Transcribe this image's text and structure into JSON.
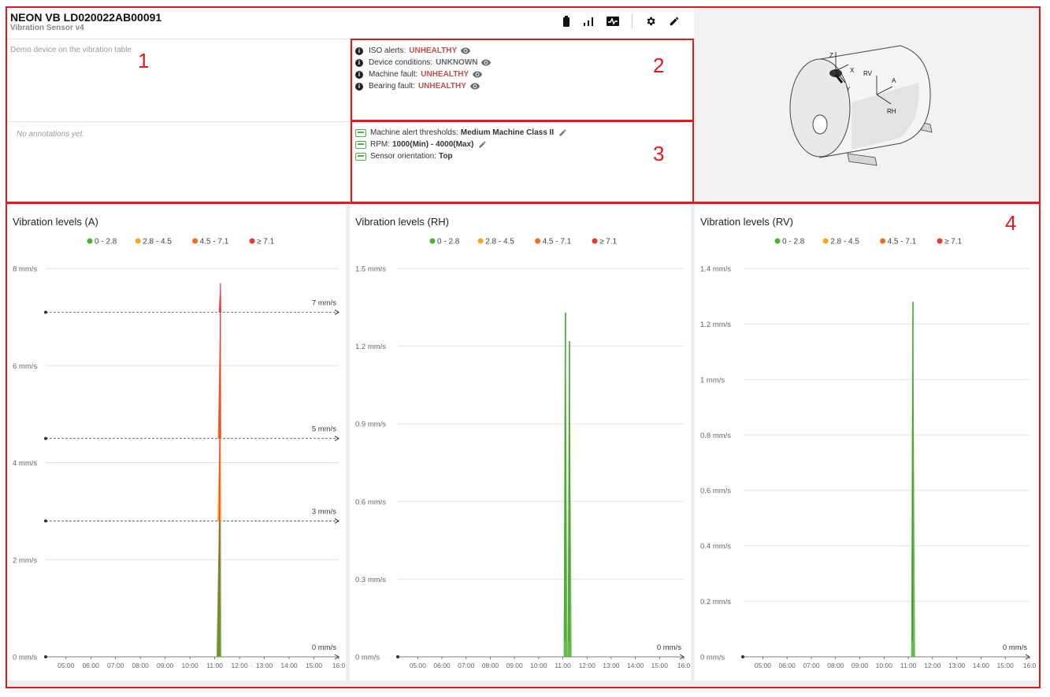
{
  "device": {
    "name": "NEON VB LD020022AB00091",
    "model": "Vibration Sensor v4",
    "description": "Demo device on the vibration table",
    "annotations_empty": "No annotations yet."
  },
  "header_icons": [
    "battery-icon",
    "signal-icon",
    "network-icon",
    "gear-icon",
    "pencil-icon"
  ],
  "status": [
    {
      "label": "ISO alerts:",
      "value": "UNHEALTHY",
      "kind": "bad"
    },
    {
      "label": "Device conditions:",
      "value": "UNKNOWN",
      "kind": "unk"
    },
    {
      "label": "Machine fault:",
      "value": "UNHEALTHY",
      "kind": "bad"
    },
    {
      "label": "Bearing fault:",
      "value": "UNHEALTHY",
      "kind": "bad"
    }
  ],
  "config": [
    {
      "label": "Machine alert thresholds:",
      "value": "Medium Machine Class II",
      "editable": true
    },
    {
      "label": "RPM:",
      "value": "1000(Min) - 4000(Max)",
      "editable": true
    },
    {
      "label": "Sensor orientation:",
      "value": "Top",
      "editable": false
    }
  ],
  "annotation_labels": [
    "1",
    "2",
    "3",
    "4"
  ],
  "motor_axes": {
    "z": "Z",
    "x": "X",
    "y": "Y",
    "rv": "RV",
    "a": "A",
    "rh": "RH"
  },
  "legend": [
    {
      "label": "0 - 2.8",
      "color": "#4caf2f"
    },
    {
      "label": "2.8 - 4.5",
      "color": "#f5a623"
    },
    {
      "label": "4.5 - 7.1",
      "color": "#ee6c1c"
    },
    {
      "label": "≥ 7.1",
      "color": "#e53935"
    }
  ],
  "chart_data": [
    {
      "type": "line",
      "title": "Vibration levels (A)",
      "unit": "mm/s",
      "ylim": [
        0,
        8
      ],
      "yticks": [
        0,
        2,
        4,
        6,
        8
      ],
      "ytick_labels": [
        "0 mm/s",
        "2 mm/s",
        "4 mm/s",
        "6 mm/s",
        "8 mm/s"
      ],
      "xticks": [
        "05:00",
        "06:00",
        "07:00",
        "08:00",
        "09:00",
        "10:00",
        "11:00",
        "12:00",
        "13:00",
        "14:00",
        "15:00",
        "16:0"
      ],
      "thresholds": [
        {
          "value": 7.1,
          "label": "7 mm/s"
        },
        {
          "value": 4.5,
          "label": "5 mm/s"
        },
        {
          "value": 2.8,
          "label": "3 mm/s"
        }
      ],
      "zero_label": "0 mm/s",
      "peak": {
        "time": "11:10",
        "value": 7.7
      }
    },
    {
      "type": "line",
      "title": "Vibration levels (RH)",
      "unit": "mm/s",
      "ylim": [
        0,
        1.5
      ],
      "yticks": [
        0,
        0.3,
        0.6,
        0.9,
        1.2,
        1.5
      ],
      "ytick_labels": [
        "0 mm/s",
        "0.3 mm/s",
        "0.6 mm/s",
        "0.9 mm/s",
        "1.2 mm/s",
        "1.5 mm/s"
      ],
      "xticks": [
        "05:00",
        "06:00",
        "07:00",
        "08:00",
        "09:00",
        "10:00",
        "11:00",
        "12:00",
        "13:00",
        "14:00",
        "15:00",
        "16:0"
      ],
      "thresholds": [],
      "zero_label": "0 mm/s",
      "peaks": [
        {
          "time": "11:05",
          "value": 1.33
        },
        {
          "time": "11:15",
          "value": 1.22
        }
      ]
    },
    {
      "type": "line",
      "title": "Vibration levels (RV)",
      "unit": "mm/s",
      "ylim": [
        0,
        1.4
      ],
      "yticks": [
        0,
        0.2,
        0.4,
        0.6,
        0.8,
        1.0,
        1.2,
        1.4
      ],
      "ytick_labels": [
        "0 mm/s",
        "0.2 mm/s",
        "0.4 mm/s",
        "0.6 mm/s",
        "0.8 mm/s",
        "1 mm/s",
        "1.2 mm/s",
        "1.4 mm/s"
      ],
      "xticks": [
        "05:00",
        "06:00",
        "07:00",
        "08:00",
        "09:00",
        "10:00",
        "11:00",
        "12:00",
        "13:00",
        "14:00",
        "15:00",
        "16:0"
      ],
      "thresholds": [],
      "zero_label": "0 mm/s",
      "peak": {
        "time": "11:10",
        "value": 1.28
      }
    }
  ]
}
